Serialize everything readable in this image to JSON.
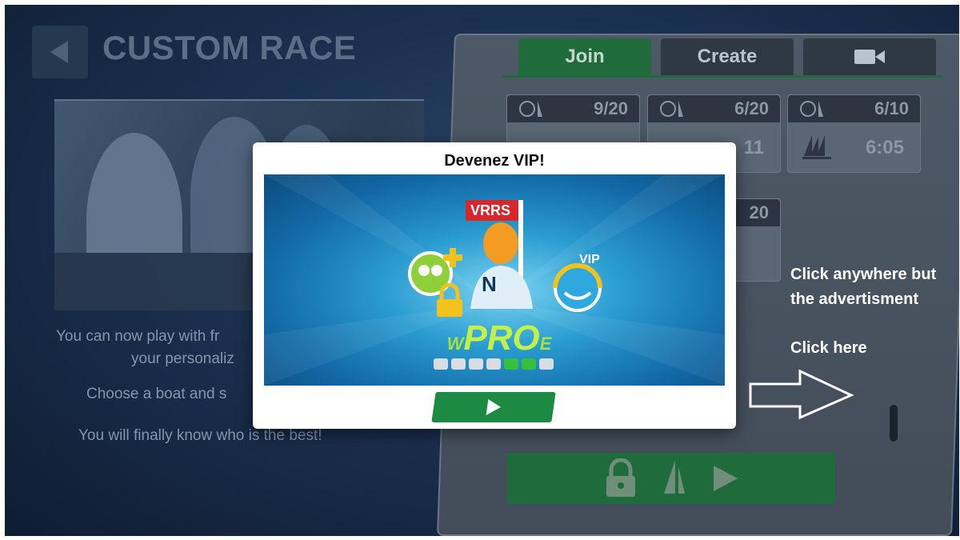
{
  "header": {
    "title": "CUSTOM RACE"
  },
  "description": {
    "line1": "You can now play with fr",
    "line2": "your personaliz",
    "line3": "Choose a boat and s",
    "line4": "You will finally know who is the best!"
  },
  "tabs": [
    {
      "label": "Join",
      "active": true
    },
    {
      "label": "Create",
      "active": false
    },
    {
      "label": "",
      "icon": "video-camera-icon"
    }
  ],
  "races": [
    {
      "players": "9/20",
      "time": ""
    },
    {
      "players": "6/20",
      "time": "11"
    },
    {
      "players": "6/10",
      "time": "6:05"
    },
    {
      "players": "20",
      "time": ""
    }
  ],
  "modal": {
    "title": "Devenez VIP!",
    "ad_badge": "VRRS",
    "ad_logo_left": "W",
    "ad_logo_main": "PRO",
    "ad_logo_right": "E",
    "ad_letter": "N",
    "ad_vip": "VIP"
  },
  "overlay_hint": {
    "line1": "Click anywhere but",
    "line2": "the advertisment",
    "line3": "Click here"
  },
  "colors": {
    "accent_green": "#1f6b3c",
    "background": "#1b3050",
    "hint_text": "#ffffff"
  }
}
